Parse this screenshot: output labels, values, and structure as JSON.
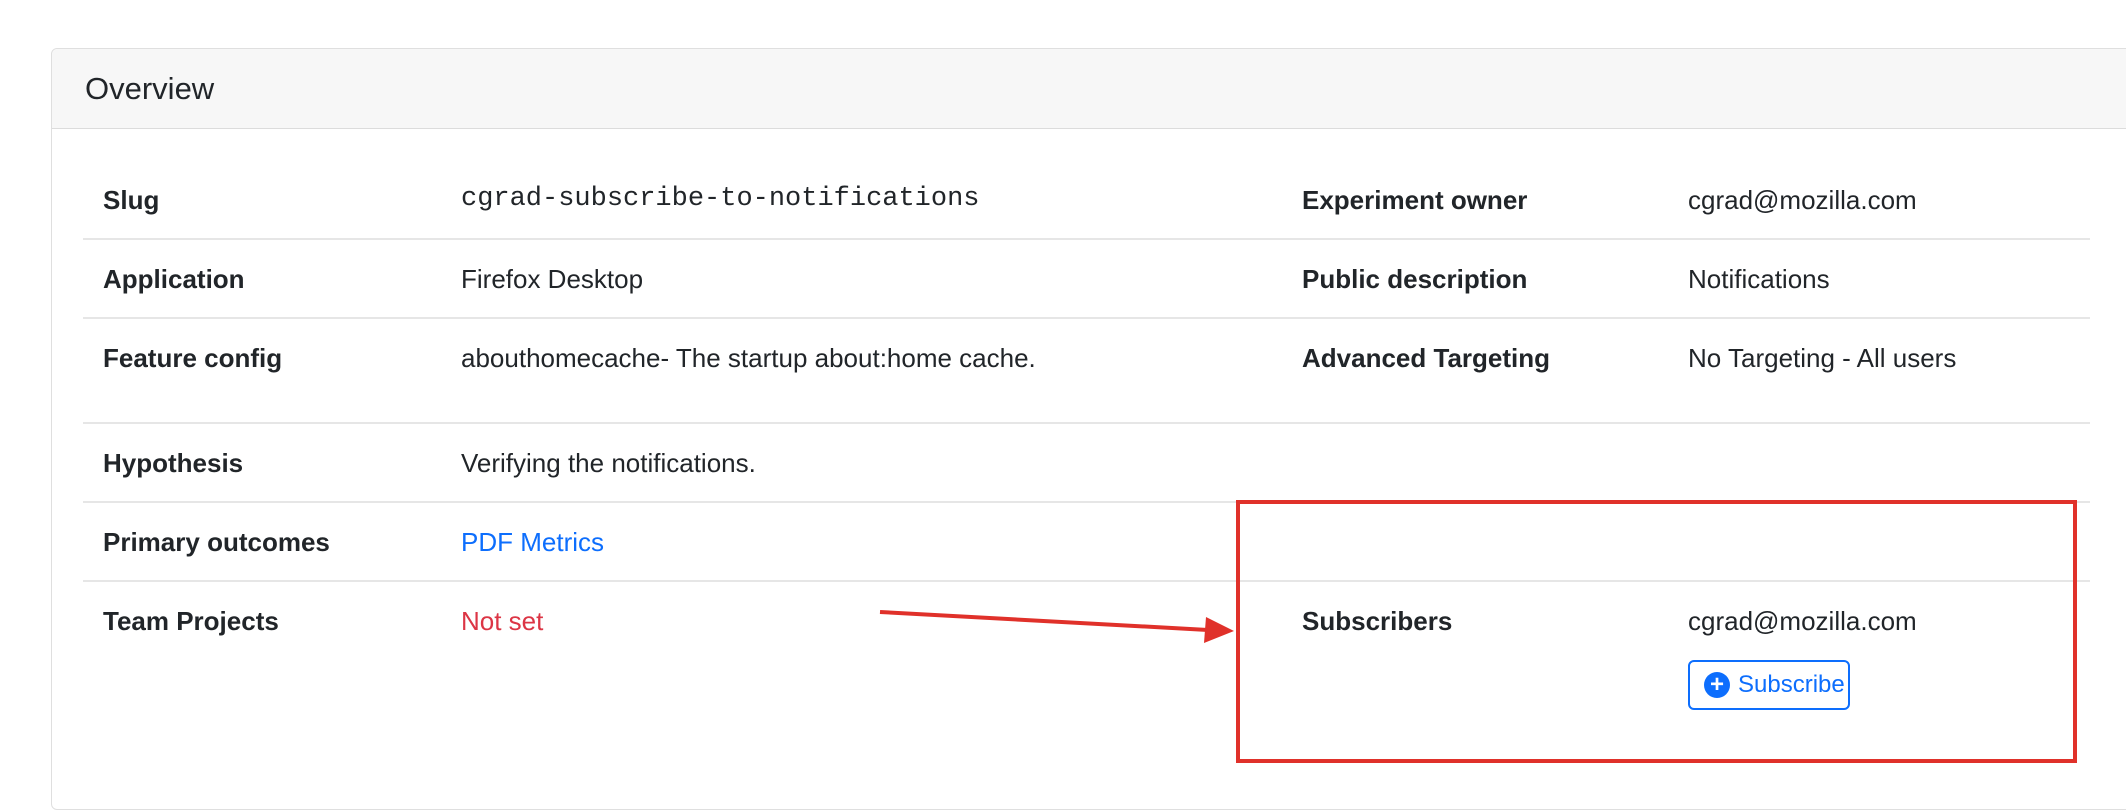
{
  "card": {
    "title": "Overview"
  },
  "rows": [
    {
      "left_label": "Slug",
      "left_value": "cgrad-subscribe-to-notifications",
      "right_label": "Experiment owner",
      "right_value": "cgrad@mozilla.com"
    },
    {
      "left_label": "Application",
      "left_value": "Firefox Desktop",
      "right_label": "Public description",
      "right_value": "Notifications"
    },
    {
      "left_label": "Feature config",
      "left_value": "abouthomecache- The startup about:home cache.",
      "right_label": "Advanced Targeting",
      "right_value": "No Targeting - All users"
    },
    {
      "left_label": "Hypothesis",
      "left_value": "Verifying the notifications."
    },
    {
      "left_label": "Primary outcomes",
      "left_value": "PDF Metrics"
    },
    {
      "left_label": "Team Projects",
      "left_value": "Not set",
      "right_label": "Subscribers",
      "right_value": "cgrad@mozilla.com"
    }
  ],
  "subscribe_button": {
    "label": "Subscribe",
    "icon": "plus-circle-icon"
  },
  "colors": {
    "link": "#0d6efd",
    "danger": "#dc3545",
    "annotation": "#e0312a",
    "header_bg": "#f7f7f7"
  }
}
